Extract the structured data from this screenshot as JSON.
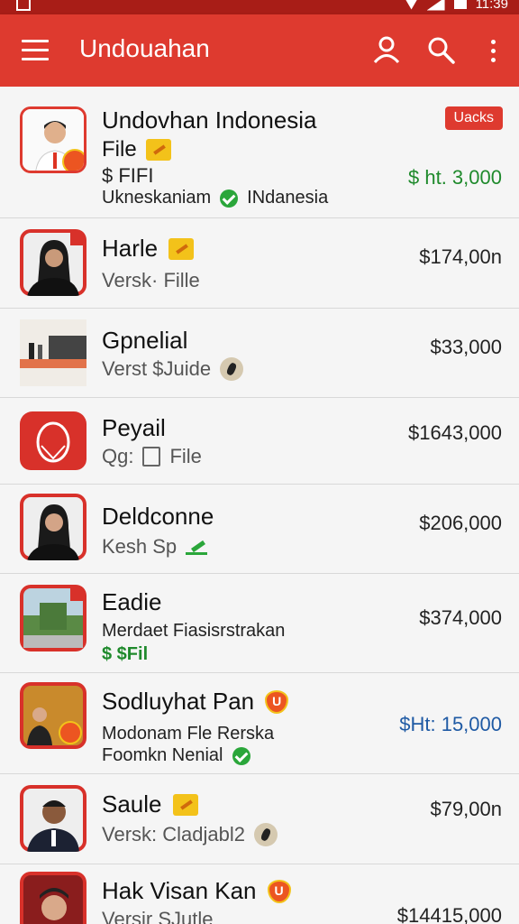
{
  "app": {
    "title": "Undouahan",
    "status_time": "11:39",
    "colors": {
      "primary": "#de3a2f",
      "status": "#a81d17",
      "green": "#1f8a2c",
      "blue": "#1f5aa4"
    },
    "icons": {
      "menu": "menu-icon",
      "account": "account-icon",
      "search": "search-icon",
      "more": "more-vert-icon"
    }
  },
  "items": [
    {
      "title": "Undovhan Indonesia",
      "line1": "File",
      "line1_icon": "yellow-badge-icon",
      "line2": "$ FIFI",
      "line3": "Ukneskaniam",
      "line3b": "INdanesia",
      "price": "$ ht. 3,000",
      "badge": "Uacks"
    },
    {
      "title": "Harle",
      "line1": "Versk·  Fille",
      "price": "$174,00n"
    },
    {
      "title": "Gpnelial",
      "line1": "Verst  $Juide",
      "price": "$33,000"
    },
    {
      "title": "Peyail",
      "line1_a": "Qg:",
      "line1_b": "File",
      "price": "$1643,000"
    },
    {
      "title": "Deldconne",
      "line1": "Kesh  Sp",
      "price": "$206,000"
    },
    {
      "title": "Eadie",
      "line1": "Merdaet Fiasisrstrakan",
      "line2": "$ $Fil",
      "price": "$374,000"
    },
    {
      "title": "Sodluyhat Pan",
      "line1": "Modonam Fle Rerska",
      "line2": "Foomkn Nenial",
      "price": "$Ht: 15,000"
    },
    {
      "title": "Saule",
      "line1": "Versk:  Cladjabl2",
      "price": "$79,00n"
    },
    {
      "title": "Hak Visan Kan",
      "line1": "Versir  SJutle",
      "price": "$14415,000"
    }
  ]
}
